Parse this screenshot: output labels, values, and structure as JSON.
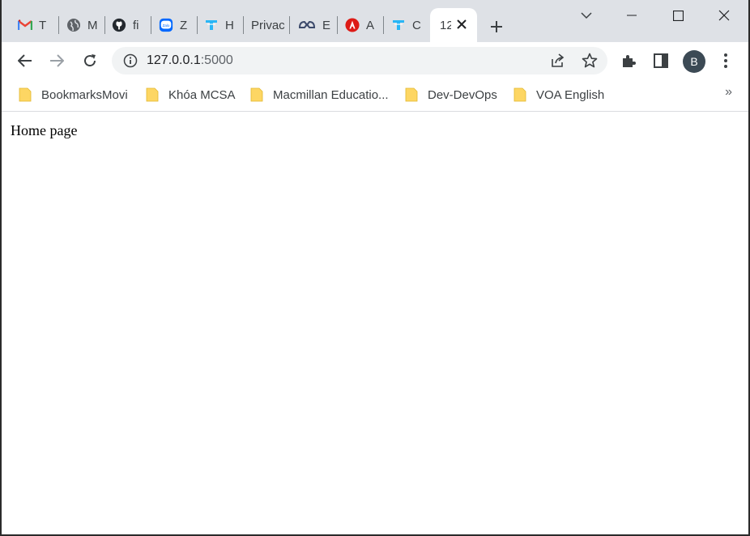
{
  "tabs": [
    {
      "title": "T",
      "icon": "gmail-icon"
    },
    {
      "title": "M",
      "icon": "globe-icon"
    },
    {
      "title": "fi",
      "icon": "github-icon"
    },
    {
      "title": "Z",
      "icon": "zalo-icon"
    },
    {
      "title": "H",
      "icon": "teams-icon"
    },
    {
      "title": "Privac",
      "icon": "none"
    },
    {
      "title": "E",
      "icon": "link-logo-icon"
    },
    {
      "title": "A",
      "icon": "angular-icon"
    },
    {
      "title": "C",
      "icon": "teams-icon"
    },
    {
      "title": "12",
      "icon": "none",
      "active": true
    }
  ],
  "address": {
    "host": "127.0.0.1",
    "port": ":5000"
  },
  "profile": {
    "initial": "B"
  },
  "bookmarks": [
    {
      "label": "BookmarksMovi"
    },
    {
      "label": "Khóa MCSA"
    },
    {
      "label": "Macmillan Educatio..."
    },
    {
      "label": "Dev-DevOps"
    },
    {
      "label": "VOA English"
    }
  ],
  "bookmarks_overflow": "»",
  "page": {
    "heading": "Home page"
  },
  "colors": {
    "tabstrip": "#dee1e6",
    "omnibox": "#f1f3f4",
    "avatar": "#3c4a55",
    "folder": "#fdd663"
  }
}
